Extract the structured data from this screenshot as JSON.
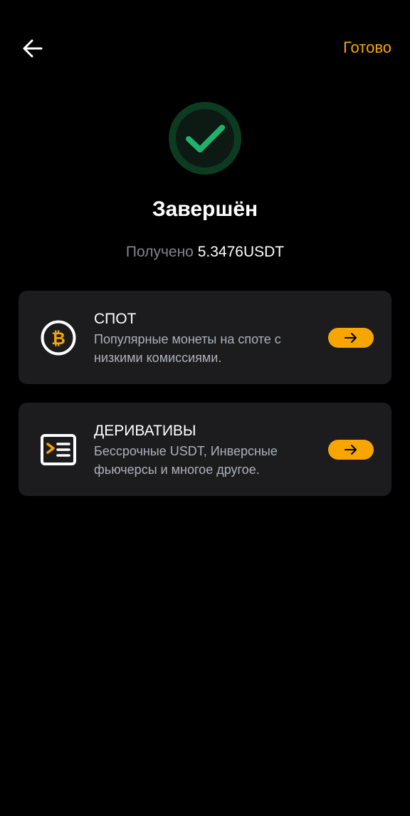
{
  "header": {
    "back_icon": "arrow-left-icon",
    "done_label": "Готово"
  },
  "status": {
    "icon": "check-circle-icon",
    "title": "Завершён",
    "received_label": "Получено",
    "received_amount": "5.3476",
    "received_unit": "USDT"
  },
  "cards": [
    {
      "icon": "bitcoin-icon",
      "title": "СПОТ",
      "description": "Популярные монеты на споте с низкими комиссиями.",
      "arrow_icon": "arrow-right-icon"
    },
    {
      "icon": "derivatives-icon",
      "title": "ДЕРИВАТИВЫ",
      "description": "Бессрочные USDT, Инверсные фьючерсы и многое другое.",
      "arrow_icon": "arrow-right-icon"
    }
  ],
  "colors": {
    "background": "#000000",
    "accent": "#f7a600",
    "success": "#20b26c",
    "card_bg": "#1c1c1f",
    "muted_text": "#81858c"
  }
}
